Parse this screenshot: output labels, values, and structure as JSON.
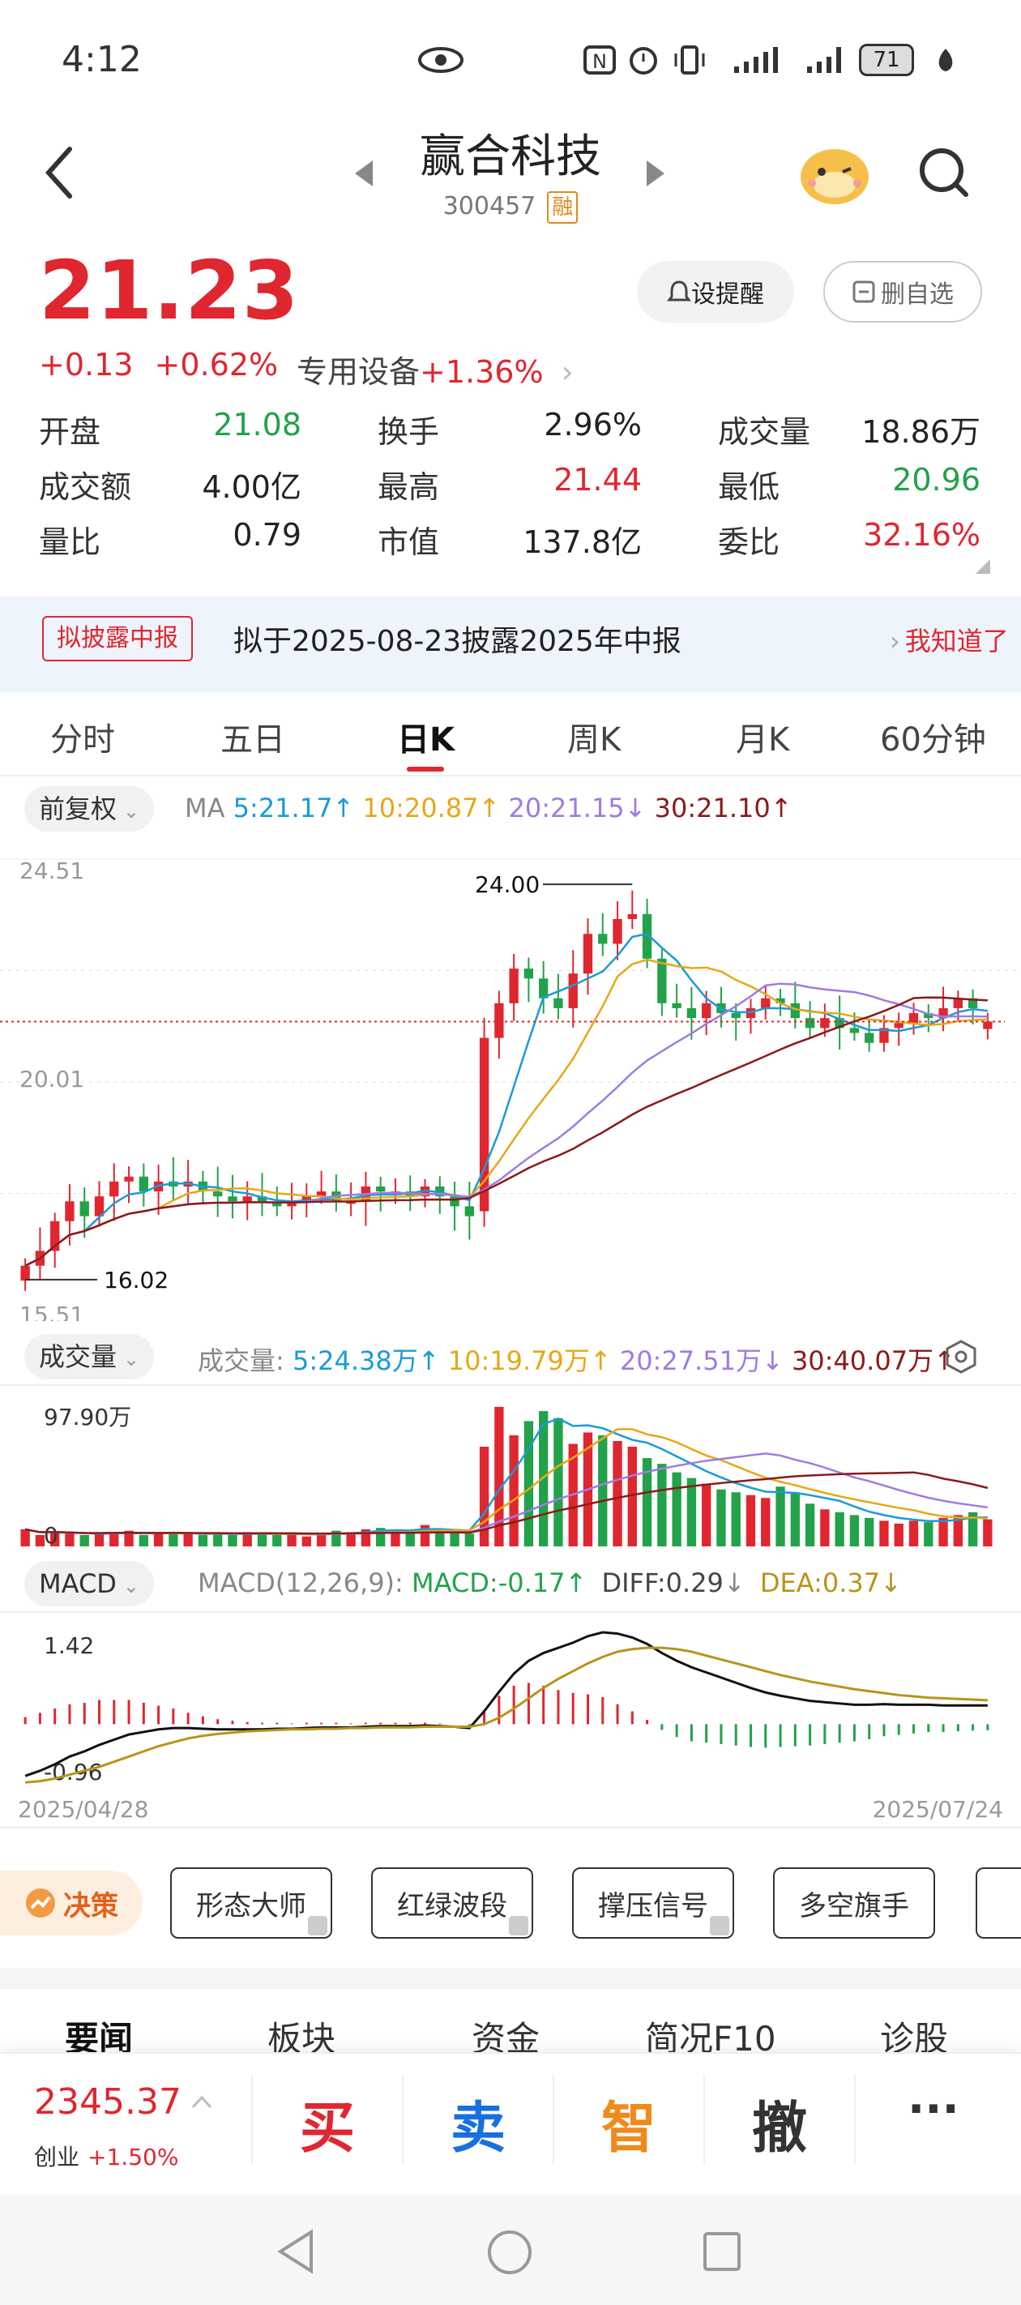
{
  "status_bar": {
    "time": "4:12",
    "battery": "71"
  },
  "header": {
    "title": "赢合科技",
    "code": "300457",
    "margin_badge": "融"
  },
  "quote": {
    "price": "21.23",
    "change": "+0.13",
    "change_pct": "+0.62%",
    "sector_label": "专用设备",
    "sector_pct": "+1.36%",
    "alert_button": "设提醒",
    "remove_button": "删自选",
    "stats": [
      {
        "label": "开盘",
        "value": "21.08",
        "color": "#22a24a"
      },
      {
        "label": "换手",
        "value": "2.96%",
        "color": "#222222"
      },
      {
        "label": "成交量",
        "value": "18.86万",
        "color": "#222222"
      },
      {
        "label": "成交额",
        "value": "4.00亿",
        "color": "#222222"
      },
      {
        "label": "最高",
        "value": "21.44",
        "color": "#e0262f"
      },
      {
        "label": "最低",
        "value": "20.96",
        "color": "#22a24a"
      },
      {
        "label": "量比",
        "value": "0.79",
        "color": "#222222"
      },
      {
        "label": "市值",
        "value": "137.8亿",
        "color": "#222222"
      },
      {
        "label": "委比",
        "value": "32.16%",
        "color": "#e0262f"
      }
    ]
  },
  "notice": {
    "tag": "拟披露中报",
    "text": "拟于2025-08-23披露2025年中报",
    "action": "我知道了"
  },
  "tabs": [
    "分时",
    "五日",
    "日K",
    "周K",
    "月K",
    "60分钟"
  ],
  "active_tab": "日K",
  "ma_legend": {
    "adjust": "前复权",
    "label": "MA",
    "ma5": "5:21.17",
    "ma10": "10:20.87",
    "ma20": "20:21.15",
    "ma30": "30:21.10"
  },
  "vol_legend": {
    "selector": "成交量",
    "label": "成交量:",
    "v5": "5:24.38万",
    "v10": "10:19.79万",
    "v20": "20:27.51万",
    "v30": "30:40.07万"
  },
  "macd_legend": {
    "selector": "MACD",
    "params": "MACD(12,26,9):",
    "macd": "MACD:-0.17",
    "diff": "DIFF:0.29",
    "dea": "DEA:0.37"
  },
  "colors": {
    "up": "#e0262f",
    "down": "#22a24a",
    "ma5": "#1a9bd7",
    "ma10": "#e6a817",
    "ma20": "#a07be0",
    "ma30": "#8b1a1a"
  },
  "chart_data": [
    {
      "type": "candlestick",
      "title": "",
      "y_axis_labels": [
        "24.51",
        "20.01",
        "15.51"
      ],
      "ylim": [
        15.51,
        24.51
      ],
      "annotations": {
        "high": "24.00",
        "low": "16.02"
      },
      "date_start": "2025/04/28",
      "date_end": "2025/07/24",
      "series": {
        "close": [
          16.3,
          16.6,
          17.2,
          17.6,
          17.3,
          17.7,
          18.0,
          18.1,
          17.8,
          18.0,
          17.9,
          18.0,
          17.8,
          17.7,
          17.6,
          17.7,
          17.6,
          17.5,
          17.6,
          17.7,
          17.8,
          17.6,
          17.6,
          17.9,
          17.8,
          17.8,
          17.7,
          17.9,
          17.7,
          17.5,
          17.3,
          20.9,
          21.6,
          22.3,
          22.1,
          21.7,
          21.5,
          22.2,
          23.0,
          22.8,
          23.3,
          23.4,
          22.5,
          21.6,
          21.5,
          21.3,
          21.6,
          21.4,
          21.3,
          21.5,
          21.7,
          21.6,
          21.3,
          21.1,
          21.3,
          21.1,
          21.0,
          20.8,
          21.1,
          21.2,
          21.4,
          21.3,
          21.5,
          21.7,
          21.5,
          21.23
        ],
        "open": [
          16.0,
          16.3,
          16.6,
          17.2,
          17.6,
          17.3,
          17.7,
          18.0,
          18.1,
          17.8,
          18.0,
          17.9,
          18.0,
          17.8,
          17.7,
          17.6,
          17.7,
          17.6,
          17.5,
          17.6,
          17.7,
          17.8,
          17.6,
          17.6,
          17.9,
          17.8,
          17.8,
          17.7,
          17.9,
          17.7,
          17.5,
          17.4,
          20.9,
          21.6,
          22.3,
          22.1,
          21.7,
          21.5,
          22.2,
          23.0,
          22.8,
          23.3,
          23.4,
          22.5,
          21.6,
          21.5,
          21.3,
          21.6,
          21.4,
          21.3,
          21.5,
          21.7,
          21.6,
          21.3,
          21.1,
          21.3,
          21.1,
          21.0,
          20.8,
          21.1,
          21.2,
          21.4,
          21.3,
          21.5,
          21.7,
          21.08
        ]
      }
    },
    {
      "type": "bar",
      "title": "成交量",
      "y_axis_labels": [
        "97.90万",
        "0"
      ],
      "ylim": [
        0,
        97.9
      ],
      "values": [
        12,
        8,
        10,
        9,
        8,
        9,
        10,
        11,
        8,
        9,
        10,
        9,
        8,
        9,
        8,
        10,
        9,
        8,
        9,
        7,
        9,
        11,
        10,
        12,
        13,
        11,
        10,
        15,
        12,
        10,
        9,
        70,
        98,
        78,
        88,
        95,
        90,
        72,
        80,
        78,
        74,
        70,
        62,
        58,
        52,
        48,
        44,
        40,
        38,
        36,
        34,
        42,
        38,
        30,
        26,
        24,
        22,
        20,
        18,
        16,
        18,
        17,
        20,
        22,
        24,
        19
      ]
    },
    {
      "type": "bar+line",
      "title": "MACD",
      "y_axis_labels": [
        "1.42",
        "-0.96"
      ],
      "ylim": [
        -0.96,
        1.42
      ],
      "diff": [
        -0.8,
        -0.72,
        -0.62,
        -0.5,
        -0.42,
        -0.32,
        -0.24,
        -0.16,
        -0.12,
        -0.08,
        -0.06,
        -0.06,
        -0.07,
        -0.08,
        -0.08,
        -0.08,
        -0.08,
        -0.07,
        -0.07,
        -0.06,
        -0.05,
        -0.05,
        -0.05,
        -0.04,
        -0.03,
        -0.03,
        -0.03,
        -0.02,
        -0.03,
        -0.04,
        -0.06,
        0.2,
        0.5,
        0.78,
        0.98,
        1.1,
        1.18,
        1.26,
        1.36,
        1.42,
        1.4,
        1.34,
        1.24,
        1.1,
        0.98,
        0.88,
        0.8,
        0.72,
        0.64,
        0.56,
        0.49,
        0.44,
        0.4,
        0.36,
        0.34,
        0.32,
        0.3,
        0.3,
        0.31,
        0.3,
        0.3,
        0.3,
        0.29,
        0.29,
        0.29,
        0.29
      ],
      "dea": [
        -0.9,
        -0.88,
        -0.84,
        -0.78,
        -0.72,
        -0.66,
        -0.58,
        -0.5,
        -0.42,
        -0.34,
        -0.28,
        -0.22,
        -0.18,
        -0.15,
        -0.13,
        -0.11,
        -0.1,
        -0.09,
        -0.08,
        -0.08,
        -0.07,
        -0.07,
        -0.06,
        -0.06,
        -0.05,
        -0.05,
        -0.05,
        -0.04,
        -0.04,
        -0.04,
        -0.04,
        0.0,
        0.1,
        0.24,
        0.4,
        0.56,
        0.7,
        0.82,
        0.94,
        1.04,
        1.12,
        1.16,
        1.18,
        1.18,
        1.16,
        1.12,
        1.06,
        1.0,
        0.94,
        0.88,
        0.82,
        0.76,
        0.71,
        0.66,
        0.62,
        0.58,
        0.54,
        0.51,
        0.48,
        0.45,
        0.43,
        0.41,
        0.4,
        0.39,
        0.38,
        0.37
      ],
      "macd": [
        0.2,
        0.32,
        0.44,
        0.56,
        0.6,
        0.68,
        0.68,
        0.68,
        0.6,
        0.52,
        0.44,
        0.32,
        0.22,
        0.14,
        0.1,
        0.06,
        0.04,
        0.04,
        0.02,
        0.04,
        0.04,
        0.04,
        0.02,
        0.04,
        0.04,
        0.04,
        0.04,
        0.04,
        0.02,
        0.0,
        -0.04,
        0.4,
        0.8,
        1.08,
        1.16,
        1.08,
        0.96,
        0.88,
        0.84,
        0.76,
        0.56,
        0.36,
        0.12,
        -0.16,
        -0.36,
        -0.48,
        -0.52,
        -0.56,
        -0.6,
        -0.64,
        -0.66,
        -0.64,
        -0.62,
        -0.6,
        -0.56,
        -0.52,
        -0.48,
        -0.42,
        -0.34,
        -0.3,
        -0.26,
        -0.22,
        -0.22,
        -0.2,
        -0.18,
        -0.17
      ]
    }
  ],
  "strategy": {
    "label": "决策",
    "tools": [
      "形态大师",
      "红绿波段",
      "撑压信号",
      "多空旗手"
    ]
  },
  "news_tabs": [
    "要闻",
    "板块",
    "资金",
    "简况F10",
    "诊股"
  ],
  "footer": {
    "index_value": "2345.37",
    "index_name": "创业",
    "index_pct": "+1.50%",
    "buy": "买",
    "sell": "卖",
    "smart": "智",
    "cancel": "撤",
    "more": "···"
  }
}
